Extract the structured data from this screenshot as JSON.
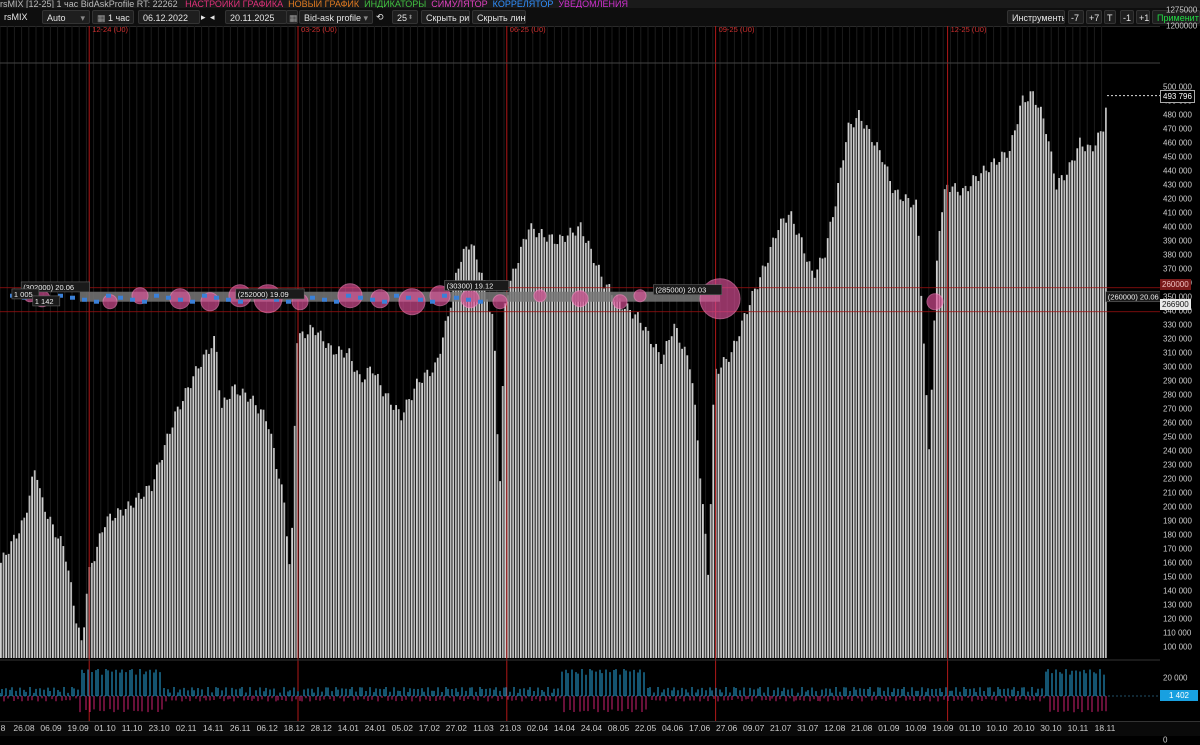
{
  "titlebar": {
    "symbol": "rsMIX [12-25] 1 час BidAskProfile RT: 22262",
    "menu": [
      {
        "label": "НАСТРОЙКИ ГРАФИКА",
        "color": "#e0307a"
      },
      {
        "label": "НОВЫЙ ГРАФИК",
        "color": "#e07a20"
      },
      {
        "label": "ИНДИКАТОРЫ",
        "color": "#40c040"
      },
      {
        "label": "СИМУЛЯТОР",
        "color": "#e040c0"
      },
      {
        "label": "КОРРЕЛЯТОР",
        "color": "#3090ff"
      },
      {
        "label": "УВЕДОМЛЕНИЯ",
        "color": "#d030d0"
      }
    ]
  },
  "toolbar": {
    "ticker": "rsMIX",
    "mode": "Auto",
    "interval": "1 час",
    "date_from": "06.12.2022",
    "date_to": "20.11.2025",
    "profile": "Bid-ask profile",
    "count": "25",
    "hide_drawings": "Скрыть рис.",
    "hide_lines": "Скрыть линии",
    "tools": "Инструменты",
    "step_minus7": "-7",
    "step_plus7": "+7",
    "t_btn": "T",
    "step_minus1": "-1",
    "step_plus1": "+1",
    "apply": "Применить"
  },
  "chart_data": {
    "type": "bar",
    "ylim": [
      92000,
      515000
    ],
    "yticks_labels": [
      "500 000",
      "490 000",
      "480 000",
      "470 000",
      "460 000",
      "450 000",
      "440 000",
      "430 000",
      "420 000",
      "410 000",
      "400 000",
      "390 000",
      "380 000",
      "370 000",
      "360 000",
      "350 000",
      "340 000",
      "330 000",
      "320 000",
      "310 000",
      "300 000",
      "290 000",
      "280 000",
      "270 000",
      "260 000",
      "250 000",
      "240 000",
      "230 000",
      "220 000",
      "210 000",
      "200 000",
      "190 000",
      "180 000",
      "170 000",
      "160 000",
      "150 000",
      "140 000",
      "130 000",
      "120 000",
      "110 000",
      "100 000"
    ],
    "yticks_values": [
      500000,
      490000,
      480000,
      470000,
      460000,
      450000,
      440000,
      430000,
      420000,
      410000,
      400000,
      390000,
      380000,
      370000,
      360000,
      350000,
      340000,
      330000,
      320000,
      310000,
      300000,
      290000,
      280000,
      270000,
      260000,
      250000,
      240000,
      230000,
      220000,
      210000,
      200000,
      190000,
      180000,
      170000,
      160000,
      150000,
      140000,
      130000,
      120000,
      110000,
      100000
    ],
    "ytop_labels": [
      "1275000",
      "1200000"
    ],
    "xticks": [
      "26.08",
      "06.09",
      "19.09",
      "01.10",
      "11.10",
      "23.10",
      "02.11",
      "14.11",
      "26.11",
      "06.12",
      "18.12",
      "28.12",
      "14.01",
      "24.01",
      "05.02",
      "17.02",
      "27.02",
      "11.03",
      "21.03",
      "02.04",
      "14.04",
      "24.04",
      "08.05",
      "22.05",
      "04.06",
      "17.06",
      "27.06",
      "09.07",
      "21.07",
      "31.07",
      "12.08",
      "21.08",
      "01.09",
      "10.09",
      "19.09",
      "01.10",
      "10.10",
      "20.10",
      "30.10",
      "10.11",
      "18.11"
    ],
    "partial_first_tick": "8",
    "contracts": [
      {
        "label": "12-24 (U0)",
        "x": 0.07
      },
      {
        "label": "03-25 (U0)",
        "x": 0.25
      },
      {
        "label": "06-25 (U0)",
        "x": 0.43
      },
      {
        "label": "09-25 (U0)",
        "x": 0.61
      },
      {
        "label": "12-25 (U0)",
        "x": 0.81
      }
    ],
    "profile_path": [
      [
        0,
        160000
      ],
      [
        0.01,
        175000
      ],
      [
        0.02,
        190000
      ],
      [
        0.03,
        230000
      ],
      [
        0.035,
        205000
      ],
      [
        0.045,
        185000
      ],
      [
        0.055,
        170000
      ],
      [
        0.065,
        120000
      ],
      [
        0.07,
        100000
      ],
      [
        0.075,
        150000
      ],
      [
        0.09,
        190000
      ],
      [
        0.11,
        200000
      ],
      [
        0.13,
        215000
      ],
      [
        0.15,
        265000
      ],
      [
        0.17,
        300000
      ],
      [
        0.185,
        320000
      ],
      [
        0.19,
        270000
      ],
      [
        0.2,
        285000
      ],
      [
        0.215,
        278000
      ],
      [
        0.23,
        262000
      ],
      [
        0.245,
        200000
      ],
      [
        0.25,
        145000
      ],
      [
        0.255,
        320000
      ],
      [
        0.27,
        328000
      ],
      [
        0.285,
        312000
      ],
      [
        0.3,
        310000
      ],
      [
        0.31,
        290000
      ],
      [
        0.32,
        300000
      ],
      [
        0.33,
        282000
      ],
      [
        0.345,
        265000
      ],
      [
        0.36,
        290000
      ],
      [
        0.375,
        300000
      ],
      [
        0.385,
        335000
      ],
      [
        0.395,
        375000
      ],
      [
        0.405,
        390000
      ],
      [
        0.415,
        365000
      ],
      [
        0.425,
        330000
      ],
      [
        0.43,
        210000
      ],
      [
        0.435,
        350000
      ],
      [
        0.445,
        375000
      ],
      [
        0.455,
        400000
      ],
      [
        0.465,
        395000
      ],
      [
        0.48,
        390000
      ],
      [
        0.5,
        400000
      ],
      [
        0.51,
        380000
      ],
      [
        0.52,
        360000
      ],
      [
        0.535,
        345000
      ],
      [
        0.55,
        335000
      ],
      [
        0.56,
        320000
      ],
      [
        0.57,
        305000
      ],
      [
        0.58,
        330000
      ],
      [
        0.595,
        300000
      ],
      [
        0.6,
        255000
      ],
      [
        0.61,
        150000
      ],
      [
        0.615,
        295000
      ],
      [
        0.63,
        310000
      ],
      [
        0.645,
        345000
      ],
      [
        0.66,
        375000
      ],
      [
        0.67,
        400000
      ],
      [
        0.68,
        410000
      ],
      [
        0.69,
        390000
      ],
      [
        0.7,
        365000
      ],
      [
        0.71,
        380000
      ],
      [
        0.72,
        420000
      ],
      [
        0.73,
        470000
      ],
      [
        0.74,
        480000
      ],
      [
        0.75,
        465000
      ],
      [
        0.76,
        450000
      ],
      [
        0.77,
        425000
      ],
      [
        0.78,
        420000
      ],
      [
        0.79,
        415000
      ],
      [
        0.8,
        240000
      ],
      [
        0.808,
        395000
      ],
      [
        0.815,
        430000
      ],
      [
        0.83,
        425000
      ],
      [
        0.84,
        435000
      ],
      [
        0.855,
        445000
      ],
      [
        0.87,
        455000
      ],
      [
        0.88,
        490000
      ],
      [
        0.89,
        495000
      ],
      [
        0.9,
        475000
      ],
      [
        0.91,
        430000
      ],
      [
        0.92,
        440000
      ],
      [
        0.93,
        460000
      ],
      [
        0.94,
        455000
      ],
      [
        0.95,
        470000
      ],
      [
        0.955,
        500000
      ],
      [
        0.96,
        505000
      ]
    ],
    "current_price": {
      "label": "493 796",
      "value": 493796
    },
    "profile_band": {
      "value": 348000
    },
    "labels": [
      {
        "text": "(302000) 20.06",
        "x": 0.02,
        "y": 355000
      },
      {
        "text": "1 005",
        "x": 0.012,
        "y": 350000
      },
      {
        "text": "1 142",
        "x": 0.03,
        "y": 345000
      },
      {
        "text": "(252000) 19.09",
        "x": 0.205,
        "y": 350000
      },
      {
        "text": "(30300) 19.12",
        "x": 0.385,
        "y": 356000
      },
      {
        "text": "(285000) 20.03",
        "x": 0.565,
        "y": 353000
      },
      {
        "text": "(260000) 20.06",
        "x": 0.955,
        "y": 348000
      }
    ],
    "right_tags": [
      {
        "label": "266900",
        "value": 344500,
        "bg": "#e8e8e8",
        "fg": "#111"
      },
      {
        "label": "260000",
        "value": 358500,
        "bg": "#7a1a1a",
        "fg": "#f0c0c0"
      }
    ],
    "sub_label": "20 000",
    "sub_value": "1 402",
    "sub_zero": "0"
  }
}
